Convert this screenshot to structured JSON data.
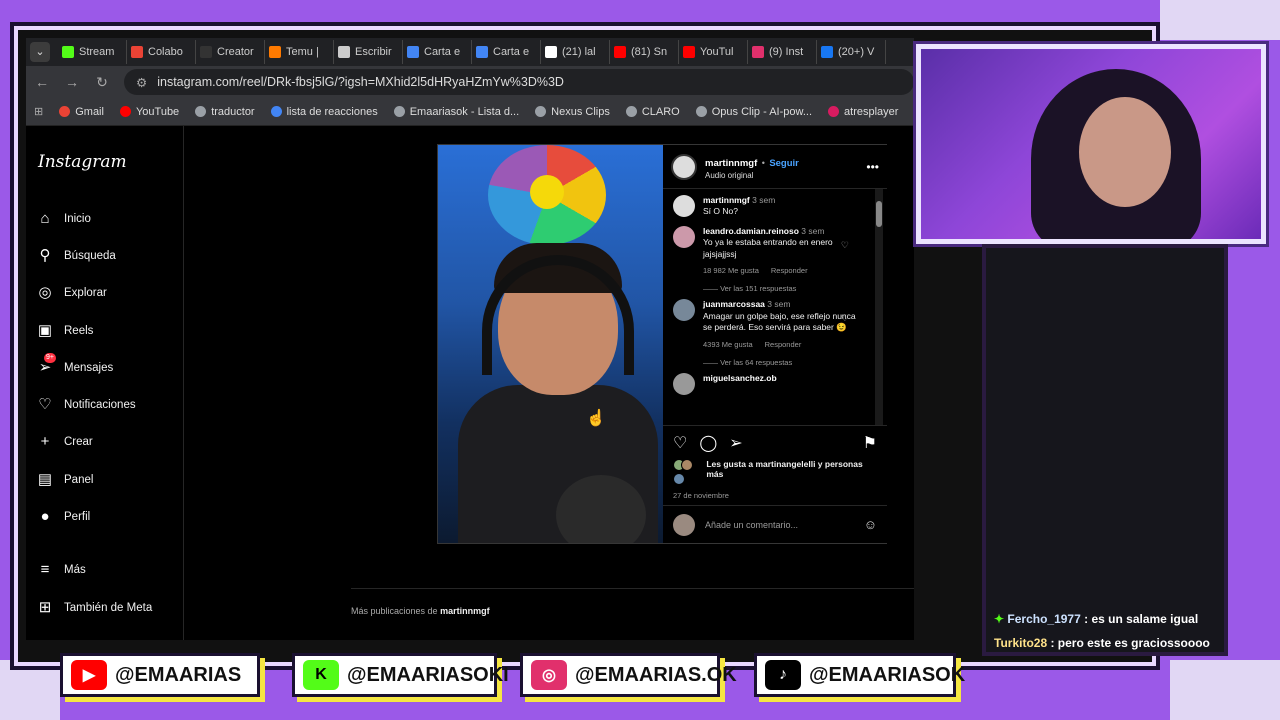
{
  "browser": {
    "tabs": [
      {
        "label": "Stream",
        "color": "#53fc18"
      },
      {
        "label": "Colabo",
        "color": "#ea4335"
      },
      {
        "label": "Creator",
        "color": "#333333"
      },
      {
        "label": "Temu |",
        "color": "#ff7a00"
      },
      {
        "label": "Escribir",
        "color": "#cccccc"
      },
      {
        "label": "Carta e",
        "color": "#4285f4"
      },
      {
        "label": "Carta e",
        "color": "#4285f4"
      },
      {
        "label": "(21) lal",
        "color": "#ffffff"
      },
      {
        "label": "(81) Sn",
        "color": "#ff0000"
      },
      {
        "label": "YouTul",
        "color": "#ff0000"
      },
      {
        "label": "(9) Inst",
        "color": "#e1306c"
      },
      {
        "label": "(20+) V",
        "color": "#1877f2"
      }
    ],
    "url": "instagram.com/reel/DRk-fbsj5lG/?igsh=MXhid2l5dHRyaHZmYw%3D%3D",
    "bookmarks": [
      {
        "label": "Gmail",
        "color": "#ea4335"
      },
      {
        "label": "YouTube",
        "color": "#ff0000"
      },
      {
        "label": "traductor",
        "color": "#9aa0a6"
      },
      {
        "label": "lista de reacciones",
        "color": "#4285f4"
      },
      {
        "label": "Emaariasok - Lista d...",
        "color": "#9aa0a6"
      },
      {
        "label": "Nexus Clips",
        "color": "#9aa0a6"
      },
      {
        "label": "CLARO",
        "color": "#9aa0a6"
      },
      {
        "label": "Opus Clip - AI-pow...",
        "color": "#9aa0a6"
      },
      {
        "label": "atresplayer",
        "color": "#d81b60"
      }
    ]
  },
  "instagram": {
    "logo": "Instagram",
    "nav": [
      {
        "label": "Inicio",
        "icon": "home-icon",
        "glyph": "⌂"
      },
      {
        "label": "Búsqueda",
        "icon": "search-icon",
        "glyph": "⚲"
      },
      {
        "label": "Explorar",
        "icon": "compass-icon",
        "glyph": "◎"
      },
      {
        "label": "Reels",
        "icon": "reels-icon",
        "glyph": "▣"
      },
      {
        "label": "Mensajes",
        "icon": "messages-icon",
        "glyph": "➢",
        "badge": "9+"
      },
      {
        "label": "Notificaciones",
        "icon": "heart-icon",
        "glyph": "♡"
      },
      {
        "label": "Crear",
        "icon": "plus-icon",
        "glyph": "+"
      },
      {
        "label": "Panel",
        "icon": "dashboard-icon",
        "glyph": "▤"
      },
      {
        "label": "Perfil",
        "icon": "avatar-icon",
        "glyph": "●"
      },
      {
        "label": "Más",
        "icon": "menu-icon",
        "glyph": "≡"
      },
      {
        "label": "También de Meta",
        "icon": "meta-icon",
        "glyph": "⊞"
      }
    ],
    "post": {
      "author": "martinnmgf",
      "follow": "Seguir",
      "audio": "Audio original",
      "comments": [
        {
          "user": "martinnmgf",
          "time": "3 sem",
          "text": "Sí O No?",
          "likes": "",
          "reply": "",
          "replies": ""
        },
        {
          "user": "leandro.damian.reinoso",
          "time": "3 sem",
          "text": "Yo ya le estaba entrando en enero jajsjajjssj",
          "likes": "18 982 Me gusta",
          "reply": "Responder",
          "replies": "Ver las 151 respuestas"
        },
        {
          "user": "juanmarcossaa",
          "time": "3 sem",
          "text": "Amagar un golpe bajo, ese reflejo nunca se perderá. Eso servirá para saber 😉",
          "likes": "4393 Me gusta",
          "reply": "Responder",
          "replies": "Ver las 64 respuestas"
        },
        {
          "user": "miguelsanchez.ob",
          "time": "",
          "text": "",
          "likes": "",
          "reply": "",
          "replies": ""
        }
      ],
      "liked_by": "Les gusta a martinangelelli y personas más",
      "date": "27 de noviembre",
      "add_comment": "Añade un comentario..."
    },
    "more_posts_prefix": "Más publicaciones de",
    "more_posts_user": "martinnmgf"
  },
  "chat": [
    {
      "user": "Fercho_1977",
      "text": ": es un salame igual"
    },
    {
      "user": "Turkito28",
      "text": ": pero este es graciossoooo"
    }
  ],
  "socials": [
    {
      "handle": "@EMAARIAS",
      "icon": "youtube-icon",
      "color": "#ff0000"
    },
    {
      "handle": "@EMAARIASOKI",
      "icon": "kick-icon",
      "color": "#53fc18"
    },
    {
      "handle": "@EMAARIAS.OK",
      "icon": "instagram-icon",
      "color": "#e1306c"
    },
    {
      "handle": "@EMAARIASOK",
      "icon": "tiktok-icon",
      "color": "#000000"
    }
  ]
}
